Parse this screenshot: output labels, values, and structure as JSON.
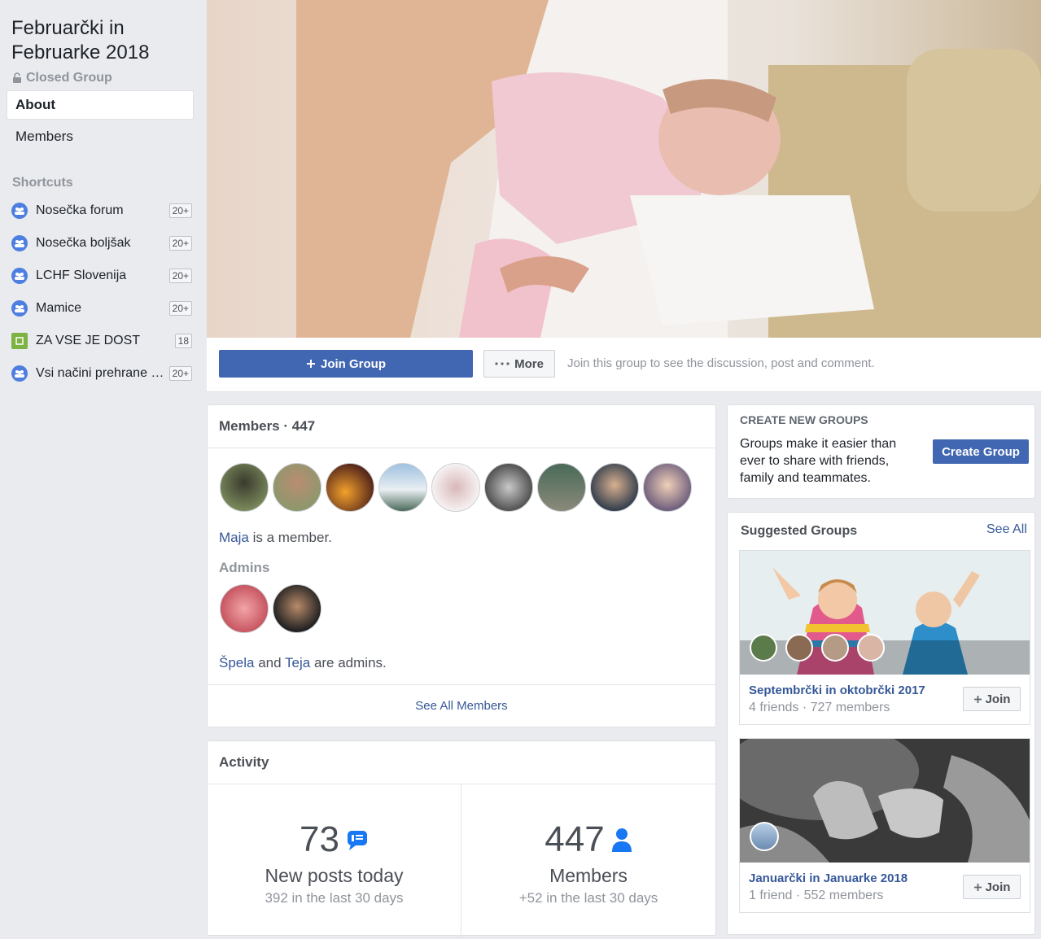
{
  "group": {
    "title": "Februarčki in Februarke 2018",
    "privacy": "Closed Group"
  },
  "nav": {
    "about": "About",
    "members": "Members"
  },
  "shortcuts": {
    "heading": "Shortcuts",
    "items": [
      {
        "label": "Nosečka forum",
        "badge": "20+"
      },
      {
        "label": "Nosečka boljšak",
        "badge": "20+"
      },
      {
        "label": "LCHF Slovenija",
        "badge": "20+"
      },
      {
        "label": "Mamice",
        "badge": "20+"
      },
      {
        "label": "ZA VSE JE DOST",
        "badge": "18"
      },
      {
        "label": "Vsi načini prehrane dojenčka",
        "badge": "20+"
      }
    ]
  },
  "actions": {
    "join": "Join Group",
    "more": "More",
    "hint": "Join this group to see the discussion, post and comment."
  },
  "members_card": {
    "title": "Members · 447",
    "member_name": "Maja",
    "member_suffix": "is a member.",
    "admins_heading": "Admins",
    "admin1": "Špela",
    "and": "and",
    "admin2": "Teja",
    "admins_suffix": "are admins.",
    "see_all": "See All Members"
  },
  "activity": {
    "title": "Activity",
    "posts_num": "73",
    "posts_label": "New posts today",
    "posts_sub": "392 in the last 30 days",
    "members_num": "447",
    "members_label": "Members",
    "members_sub": "+52 in the last 30 days"
  },
  "create": {
    "heading": "CREATE NEW GROUPS",
    "text": "Groups make it easier than ever to share with friends, family and teammates.",
    "button": "Create Group"
  },
  "suggested": {
    "heading": "Suggested Groups",
    "see_all": "See All",
    "groups": [
      {
        "name": "Septembrčki in oktobrčki 2017",
        "meta": "4 friends · 727 members",
        "join": "Join"
      },
      {
        "name": "Januarčki in Januarke 2018",
        "meta": "1 friend · 552 members",
        "join": "Join"
      }
    ]
  },
  "colors": {
    "accent": "#4267b2",
    "link": "#365899",
    "page_bg": "#e9ebee"
  }
}
